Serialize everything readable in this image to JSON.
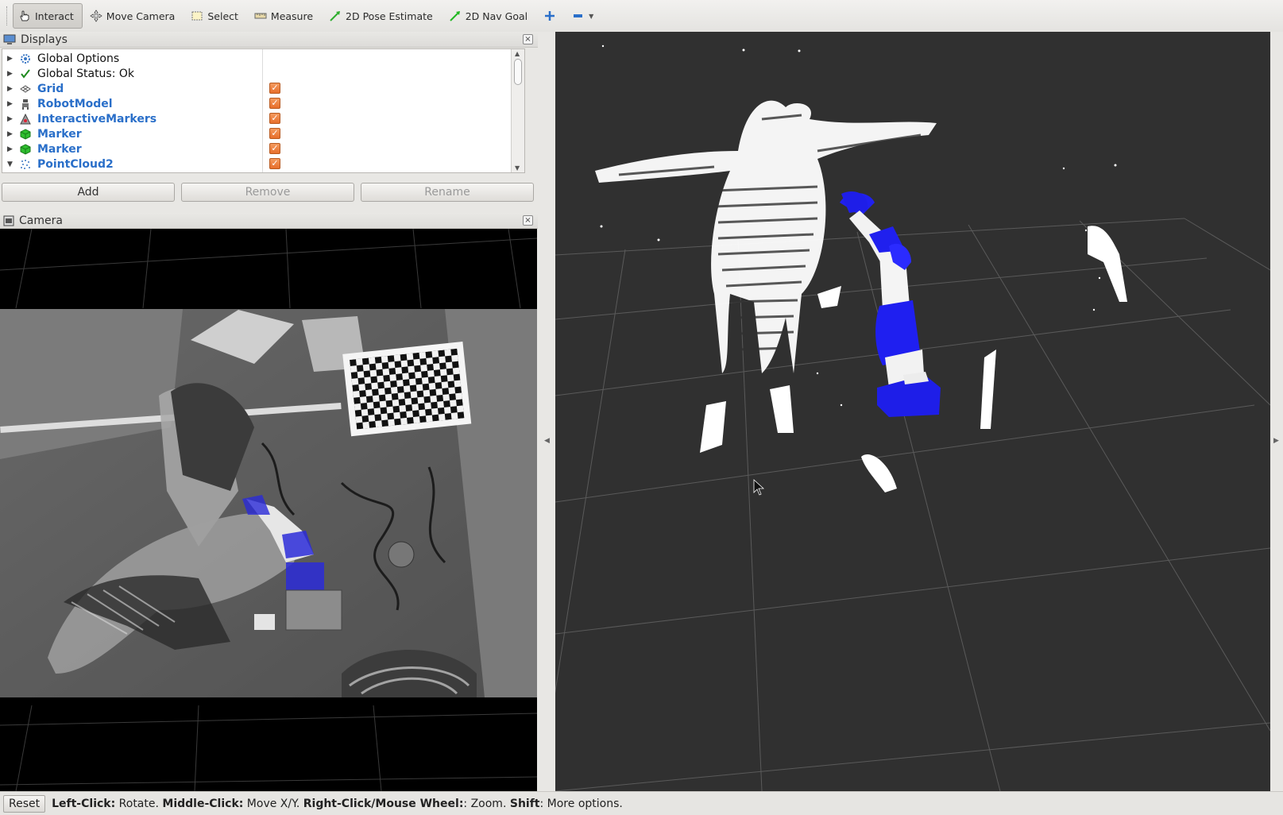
{
  "toolbar": {
    "tools": [
      {
        "label": "Interact",
        "icon": "hand-icon"
      },
      {
        "label": "Move Camera",
        "icon": "move-camera-icon"
      },
      {
        "label": "Select",
        "icon": "select-icon"
      },
      {
        "label": "Measure",
        "icon": "ruler-icon"
      },
      {
        "label": "2D Pose Estimate",
        "icon": "pose-arrow-icon"
      },
      {
        "label": "2D Nav Goal",
        "icon": "nav-arrow-icon"
      }
    ]
  },
  "displays": {
    "title": "Displays",
    "items": [
      {
        "label": "Global Options",
        "icon": "gear-icon",
        "enabled": false
      },
      {
        "label": "Global Status: Ok",
        "icon": "checkmark-icon",
        "enabled": false
      },
      {
        "label": "Grid",
        "icon": "grid-icon",
        "enabled": true,
        "checked": true
      },
      {
        "label": "RobotModel",
        "icon": "robot-icon",
        "enabled": true,
        "checked": true
      },
      {
        "label": "InteractiveMarkers",
        "icon": "interactive-markers-icon",
        "enabled": true,
        "checked": true
      },
      {
        "label": "Marker",
        "icon": "marker-cube-icon",
        "enabled": true,
        "checked": true
      },
      {
        "label": "Marker",
        "icon": "marker-cube-icon",
        "enabled": true,
        "checked": true
      },
      {
        "label": "PointCloud2",
        "icon": "pointcloud-icon",
        "enabled": true,
        "checked": true,
        "expanded": true
      }
    ],
    "buttons": {
      "add": "Add",
      "remove": "Remove",
      "rename": "Rename"
    }
  },
  "camera": {
    "title": "Camera"
  },
  "statusbar": {
    "reset": "Reset",
    "hints": [
      {
        "key": "Left-Click:",
        "text": " Rotate. "
      },
      {
        "key": "Middle-Click:",
        "text": " Move X/Y. "
      },
      {
        "key": "Right-Click/Mouse Wheel:",
        "text": ": Zoom. "
      },
      {
        "key": "Shift",
        "text": ": More options."
      }
    ]
  },
  "colors": {
    "accent": "#2a6fc9",
    "checkbox": "#e8742f",
    "robot_blue": "#1f2ff0",
    "viewport_bg": "#303030"
  }
}
